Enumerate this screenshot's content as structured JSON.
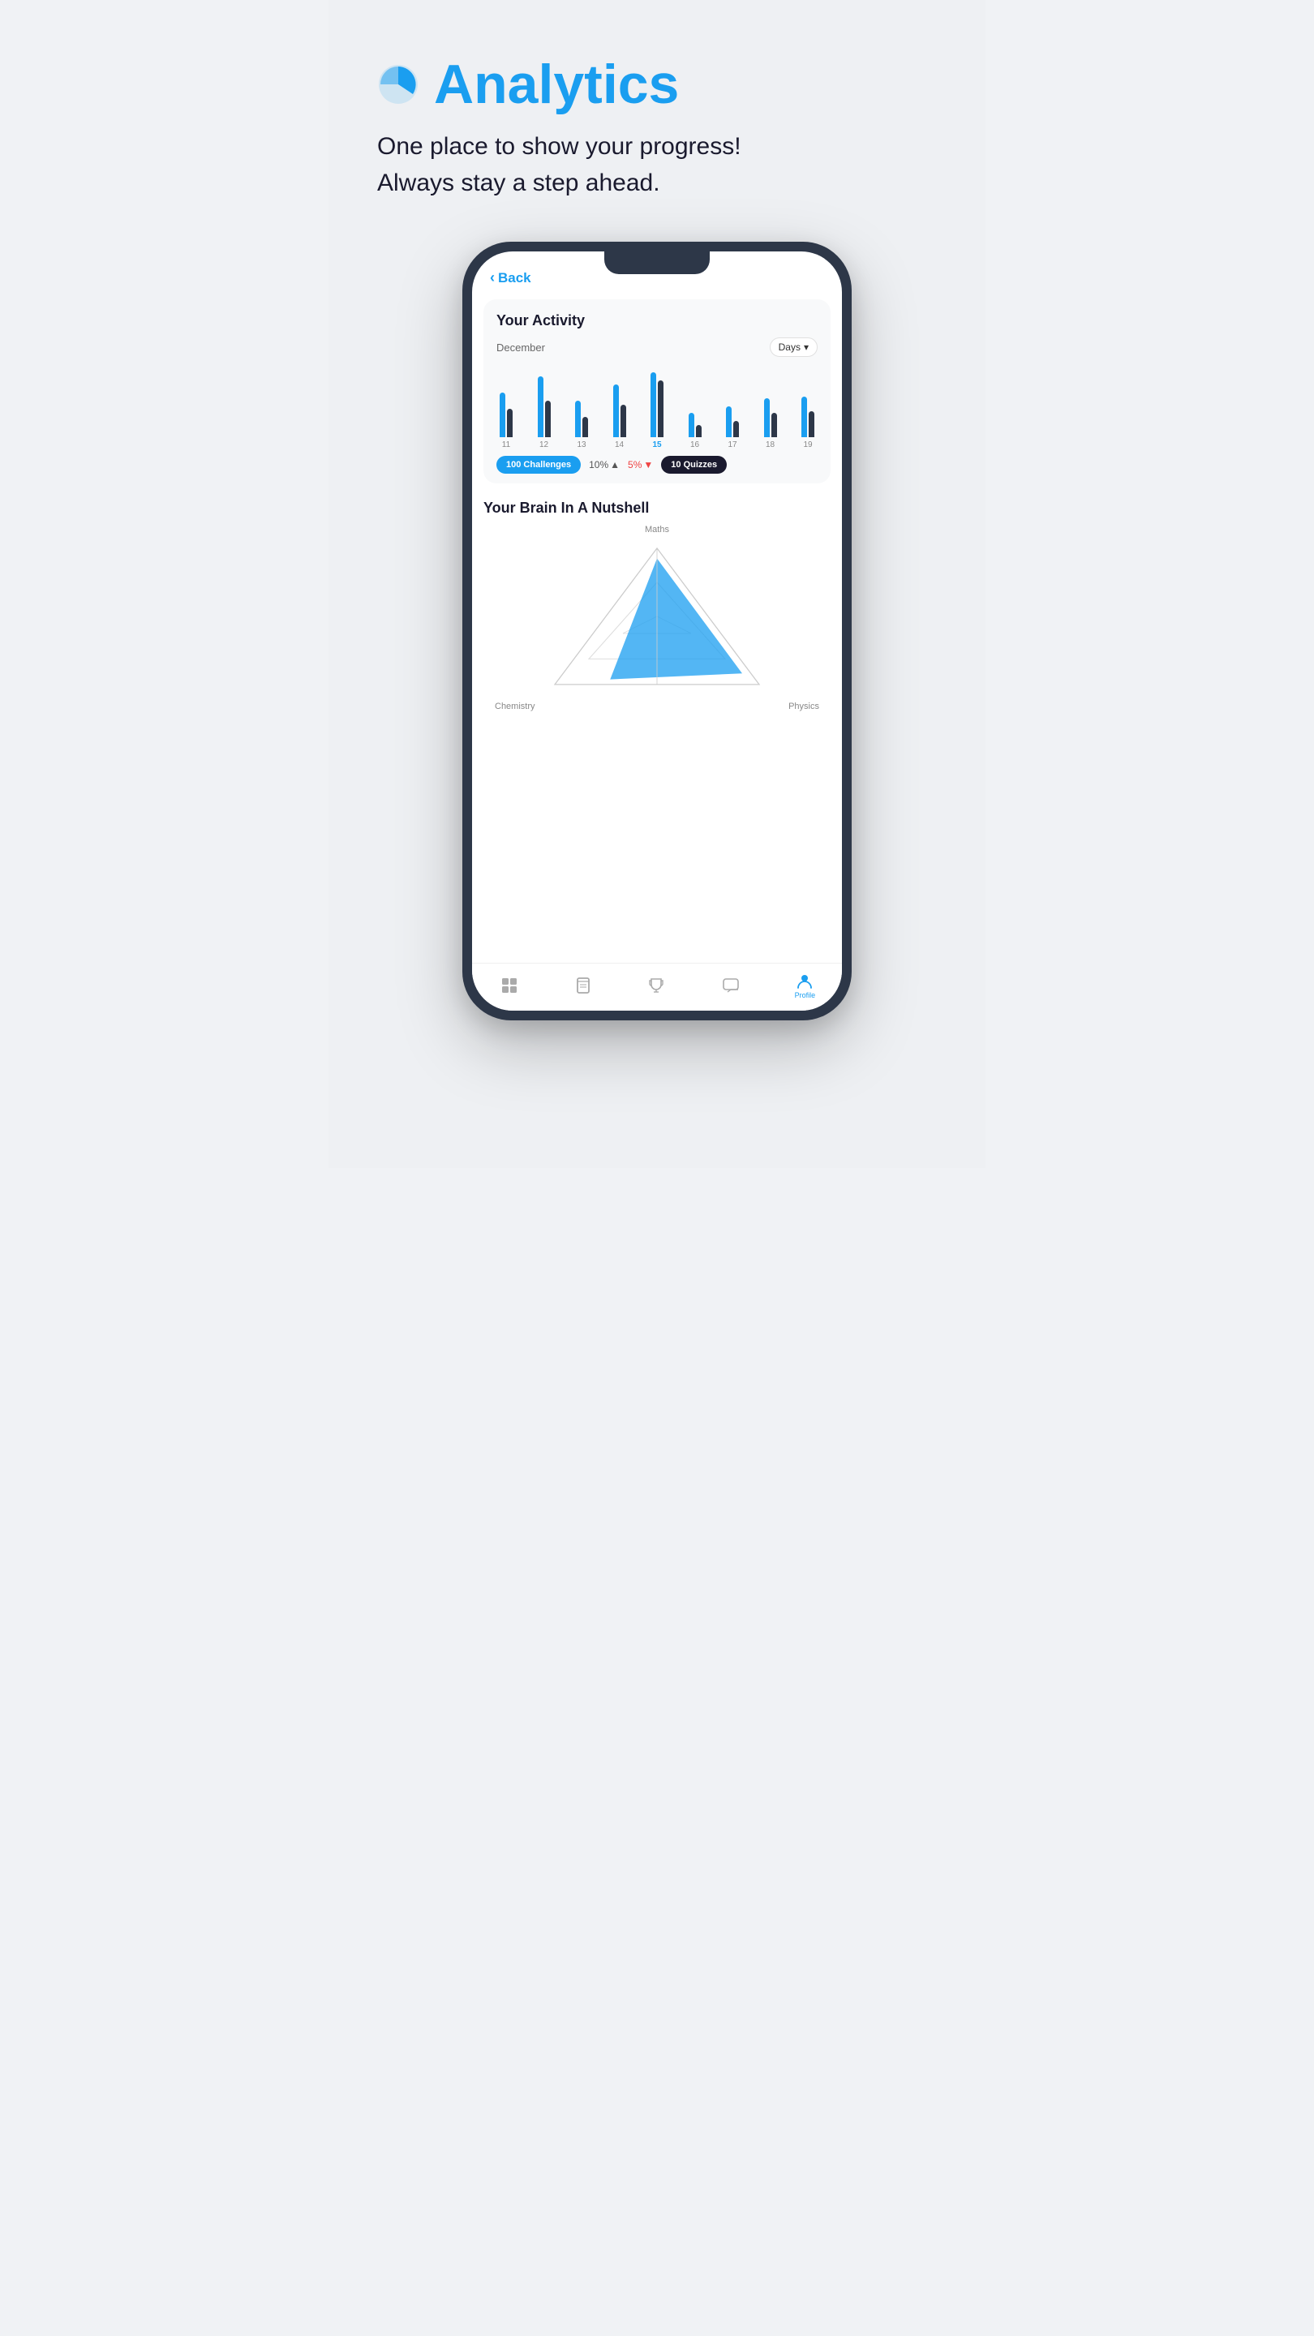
{
  "page": {
    "background": "#eef0f3"
  },
  "header": {
    "title": "Analytics",
    "subtitle_line1": "One place to show your progress!",
    "subtitle_line2": "Always stay a step ahead."
  },
  "phone": {
    "back_button": "Back",
    "activity": {
      "title": "Your Activity",
      "month": "December",
      "dropdown_label": "Days",
      "bars": [
        {
          "day": "11",
          "heights": [
            55,
            35
          ],
          "active": false
        },
        {
          "day": "12",
          "heights": [
            75,
            45
          ],
          "active": false
        },
        {
          "day": "13",
          "heights": [
            45,
            25
          ],
          "active": false
        },
        {
          "day": "14",
          "heights": [
            65,
            40
          ],
          "active": false
        },
        {
          "day": "15",
          "heights": [
            80,
            70
          ],
          "active": true
        },
        {
          "day": "16",
          "heights": [
            30,
            15
          ],
          "active": false
        },
        {
          "day": "17",
          "heights": [
            38,
            20
          ],
          "active": false
        },
        {
          "day": "18",
          "heights": [
            48,
            30
          ],
          "active": false
        },
        {
          "day": "19",
          "heights": [
            50,
            32
          ],
          "active": false
        }
      ],
      "stats": {
        "challenges_count": "100",
        "challenges_label": "Challenges",
        "percent_up": "10%",
        "percent_down": "5%",
        "quizzes_count": "10",
        "quizzes_label": "Quizzes"
      }
    },
    "brain": {
      "title": "Your Brain In A Nutshell",
      "labels": {
        "top": "Maths",
        "bottom_left": "Chemistry",
        "bottom_right": "Physics"
      }
    },
    "nav": {
      "items": [
        {
          "icon": "grid-icon",
          "label": "",
          "active": false
        },
        {
          "icon": "book-icon",
          "label": "",
          "active": false
        },
        {
          "icon": "trophy-icon",
          "label": "",
          "active": false
        },
        {
          "icon": "chat-icon",
          "label": "",
          "active": false
        },
        {
          "icon": "profile-icon",
          "label": "Profile",
          "active": true
        }
      ]
    }
  }
}
